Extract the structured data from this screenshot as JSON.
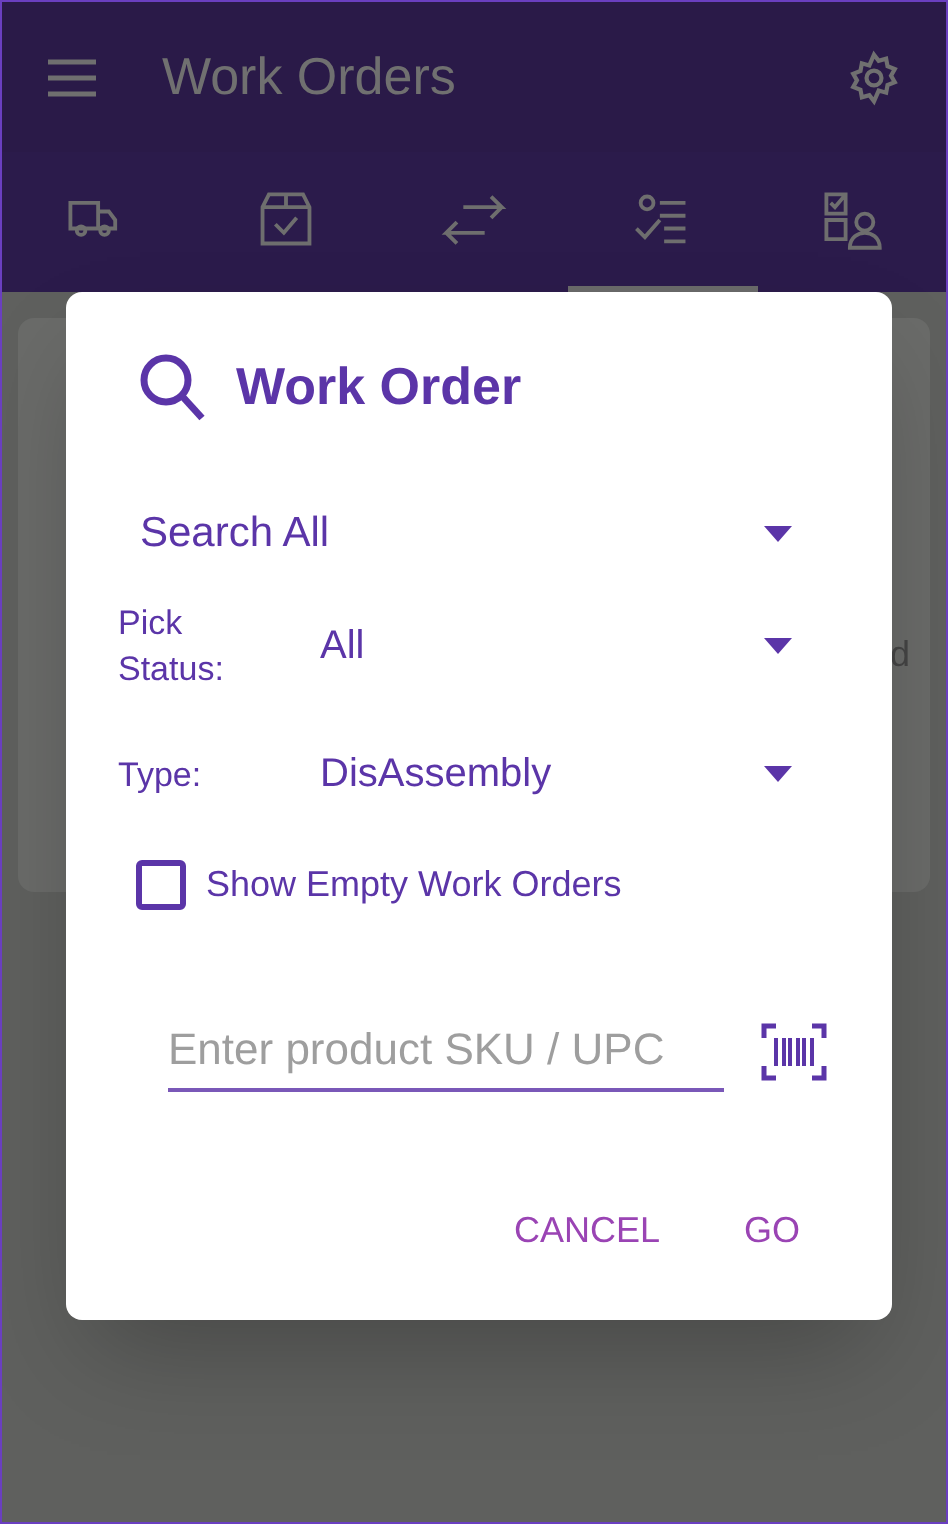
{
  "app_bar": {
    "title": "Work Orders"
  },
  "tabs": [
    {
      "kind": "truck",
      "selected": false
    },
    {
      "kind": "box",
      "selected": false
    },
    {
      "kind": "arrows",
      "selected": false
    },
    {
      "kind": "checklist",
      "selected": true
    },
    {
      "kind": "person",
      "selected": false
    }
  ],
  "background_card": {
    "text_fragment": "d"
  },
  "dialog": {
    "title": "Work Order",
    "dropdowns": [
      {
        "value": "Search All"
      },
      {
        "label": "Pick Status:",
        "value": "All"
      },
      {
        "label": "Type:",
        "value": "DisAssembly"
      }
    ],
    "checkbox": {
      "label": "Show Empty Work Orders",
      "checked": false
    },
    "search_field": {
      "placeholder": "Enter product SKU / UPC"
    },
    "buttons": [
      "CANCEL",
      "GO"
    ]
  }
}
